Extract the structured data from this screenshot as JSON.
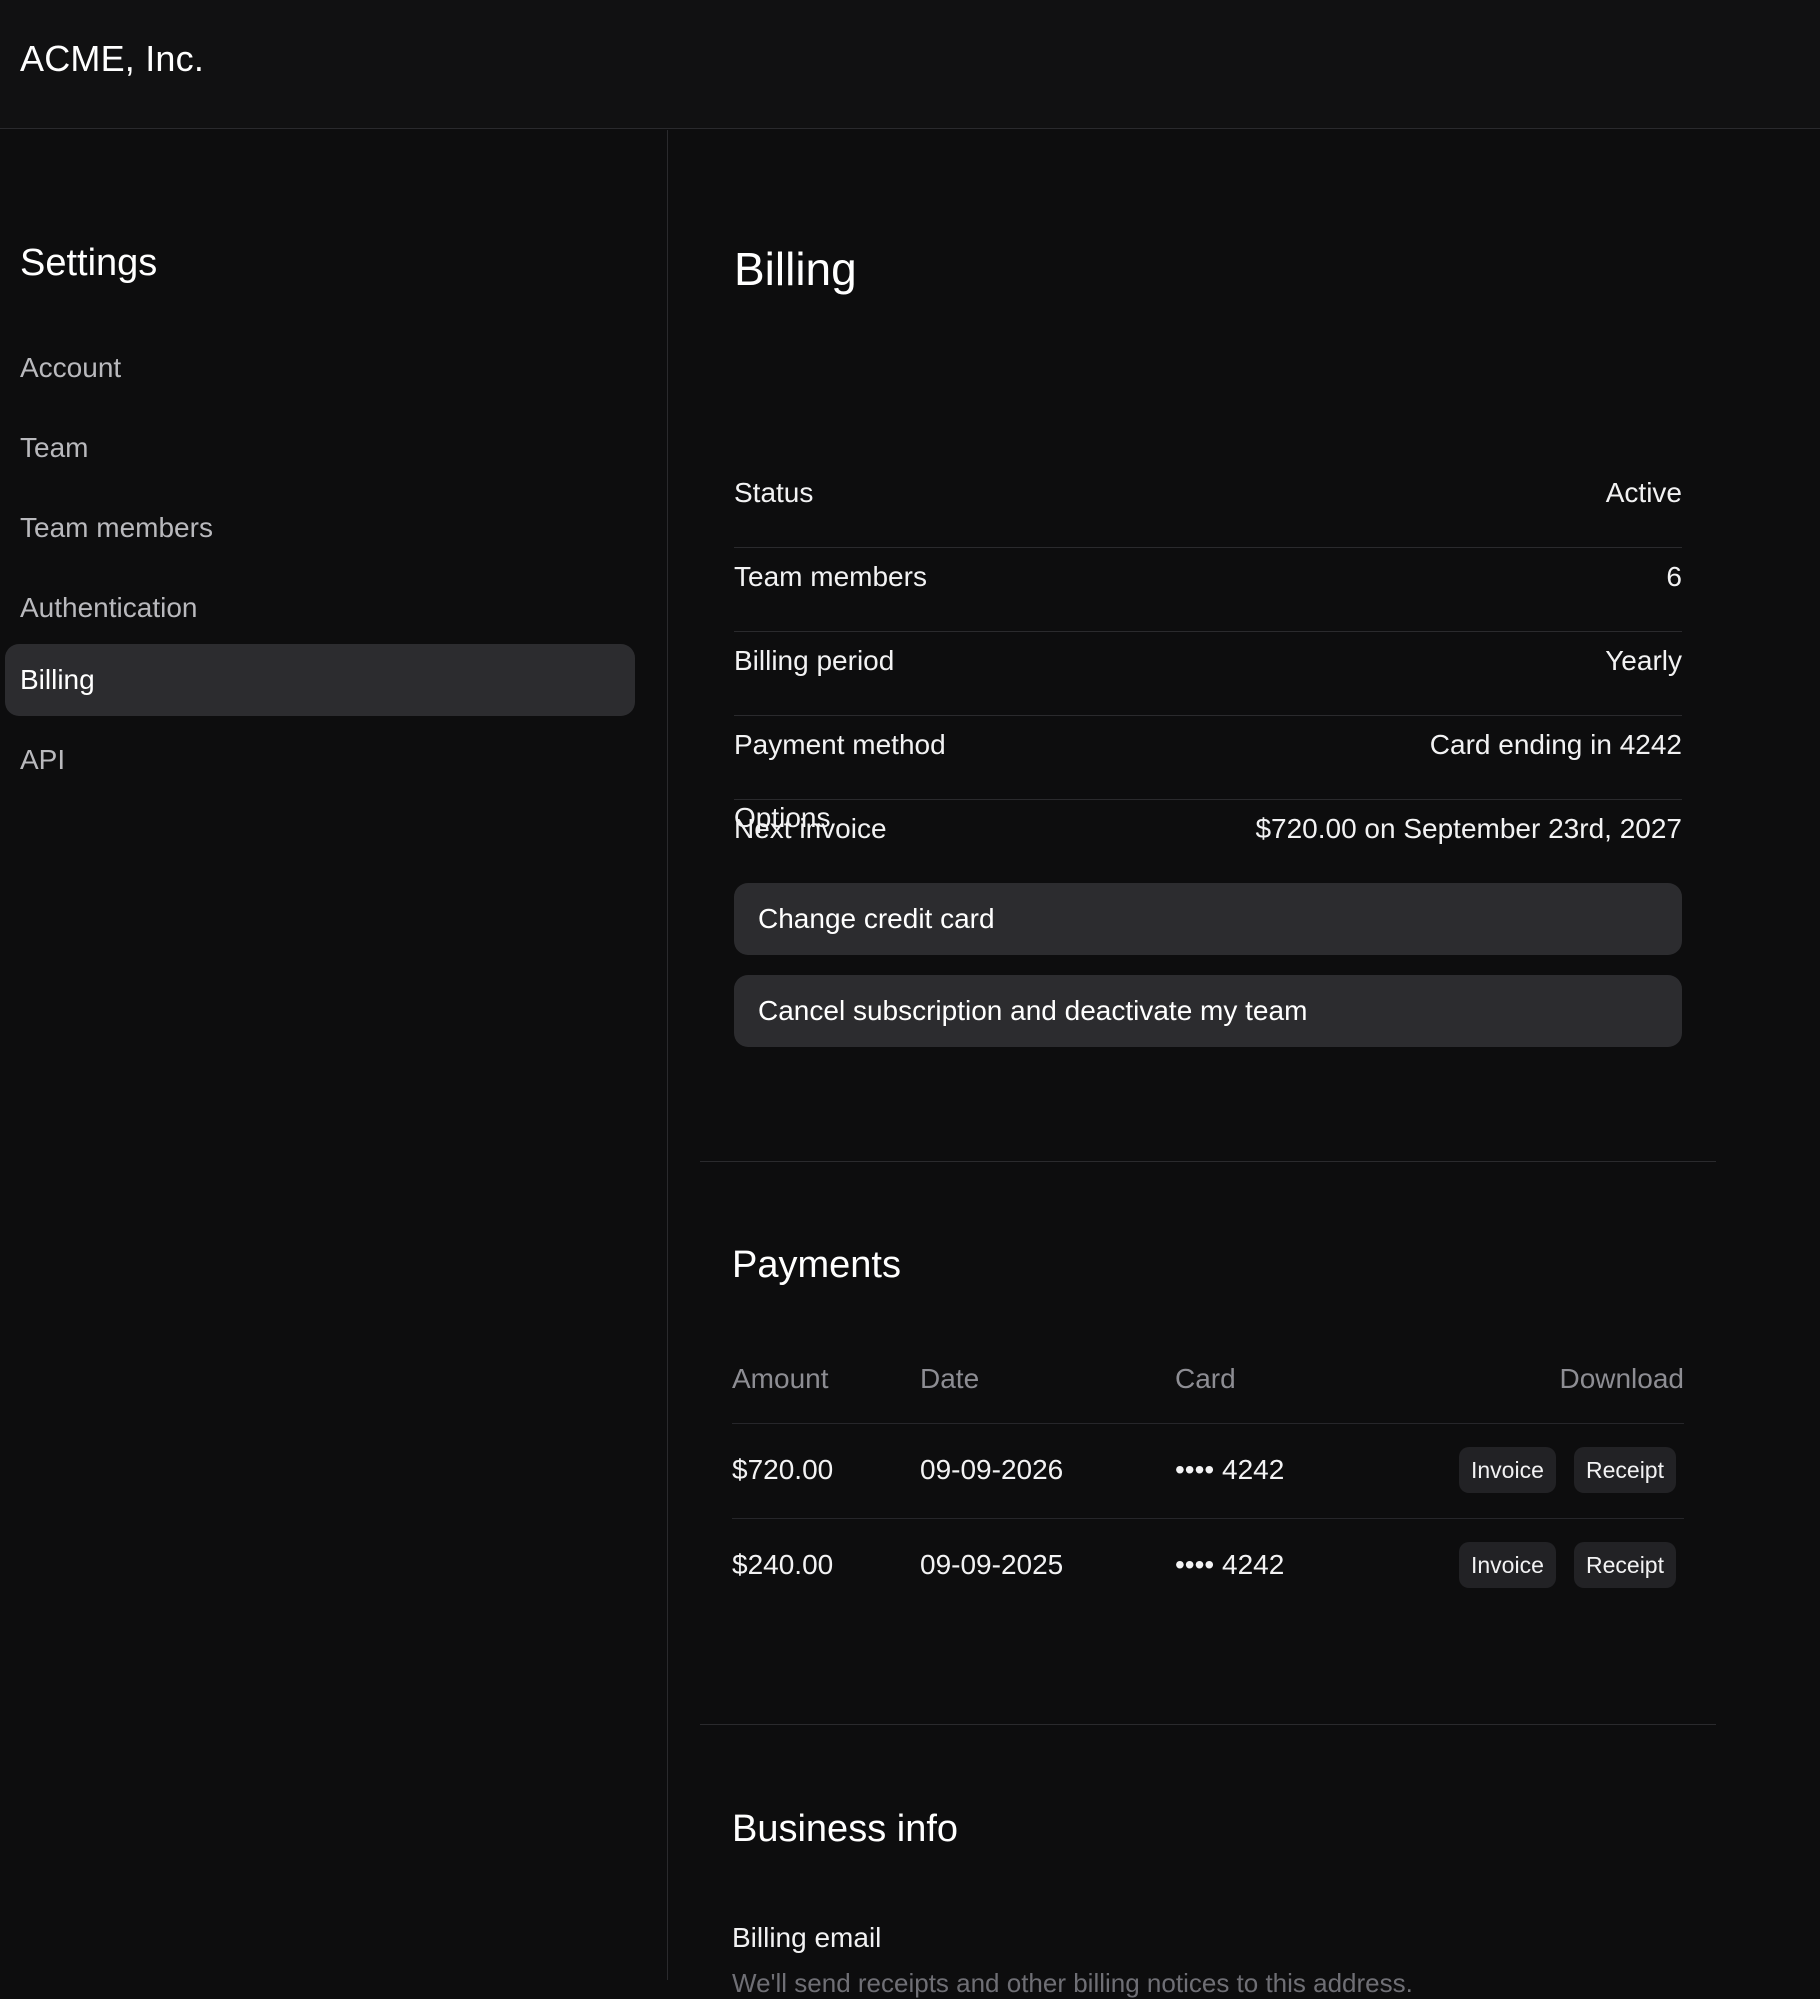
{
  "app": {
    "brand": "ACME, Inc."
  },
  "sidebar": {
    "title": "Settings",
    "items": [
      {
        "label": "Account",
        "active": false
      },
      {
        "label": "Team",
        "active": false
      },
      {
        "label": "Team members",
        "active": false
      },
      {
        "label": "Authentication",
        "active": false
      },
      {
        "label": "Billing",
        "active": true
      },
      {
        "label": "API",
        "active": false
      }
    ]
  },
  "billing": {
    "title": "Billing",
    "rows": [
      {
        "key": "Status",
        "value": "Active"
      },
      {
        "key": "Team members",
        "value": "6"
      },
      {
        "key": "Billing period",
        "value": "Yearly"
      },
      {
        "key": "Payment method",
        "value": "Card ending in 4242"
      },
      {
        "key": "Next invoice",
        "value": "$720.00 on September 23rd, 2027"
      }
    ],
    "options_label": "Options",
    "options": [
      "Change credit card",
      "Cancel subscription and deactivate my team"
    ]
  },
  "payments": {
    "title": "Payments",
    "columns": [
      "Amount",
      "Date",
      "Card",
      "Download"
    ],
    "rows": [
      {
        "amount": "$720.00",
        "date": "09-09-2026",
        "card": "•••• 4242",
        "invoice": "Invoice",
        "receipt": "Receipt"
      },
      {
        "amount": "$240.00",
        "date": "09-09-2025",
        "card": "•••• 4242",
        "invoice": "Invoice",
        "receipt": "Receipt"
      }
    ]
  },
  "business": {
    "title": "Business info",
    "billing_email_label": "Billing email",
    "billing_email_help": "We'll send receipts and other billing notices to this address."
  }
}
